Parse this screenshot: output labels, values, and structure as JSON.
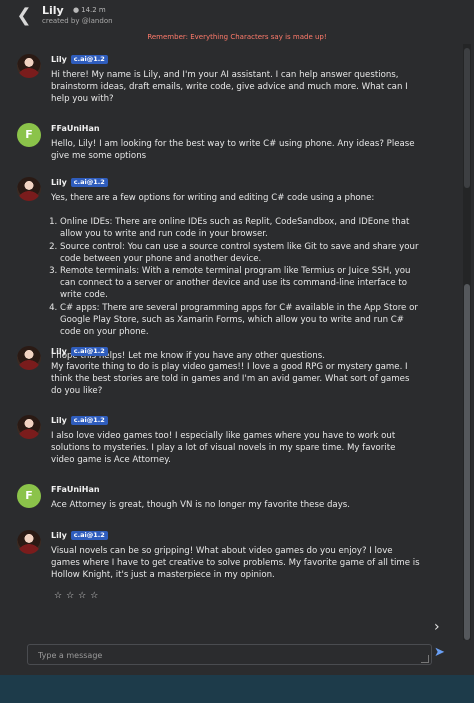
{
  "header": {
    "back_icon": "chevron-left-icon",
    "name": "Lily",
    "count": "14.2 m",
    "count_icon": "chat-icon",
    "created_by": "created by @landon"
  },
  "notice": "Remember: Everything Characters say is made up!",
  "messages": [
    {
      "sender": "Lily",
      "badge": "c.ai@1.2",
      "paragraphs": [
        "Hi there! My name is Lily, and I'm your AI assistant. I can help answer questions, brainstorm ideas, draft emails, write code, give advice and much more. What can I help you with?"
      ]
    },
    {
      "sender": "FFaUniHan",
      "avatar_letter": "F",
      "paragraphs": [
        "Hello, Lily! I am looking for the best way to write C# using phone. Any ideas? Please give me some options"
      ]
    },
    {
      "sender": "Lily",
      "badge": "c.ai@1.2",
      "intro": "Yes, there are a few options for writing and editing C# code using a phone:",
      "list": [
        "Online IDEs: There are online IDEs such as Replit, CodeSandbox, and IDEone that allow you to write and run code in your browser.",
        "Source control: You can use a source control system like Git to save and share your code between your phone and another device.",
        "Remote terminals: With a remote terminal program like Termius or Juice SSH, you can connect to a server or another device and use its command-line interface to write code.",
        "C# apps: There are several programming apps for C# available in the App Store or Google Play Store, such as Xamarin Forms, which allow you to write and run C# code on your phone."
      ],
      "outro": "I hope this helps! Let me know if you have any other questions."
    },
    {
      "sender": "Lily",
      "badge": "c.ai@1.2",
      "paragraphs": [
        "My favorite thing to do is play video games!! I love a good RPG or mystery game. I think the best stories are told in games and I'm an avid gamer. What sort of games do you like?"
      ]
    },
    {
      "sender": "Lily",
      "badge": "c.ai@1.2",
      "paragraphs": [
        "I also love video games too! I especially like games where you have to work out solutions to mysteries. I play a lot of visual novels in my spare time. My favorite video game is Ace Attorney."
      ]
    },
    {
      "sender": "FFaUniHan",
      "avatar_letter": "F",
      "paragraphs": [
        "Ace Attorney is great, though VN is no longer my favorite these days."
      ]
    },
    {
      "sender": "Lily",
      "badge": "c.ai@1.2",
      "paragraphs": [
        "Visual novels can be so gripping! What about video games do you enjoy? I love games where I have to get creative to solve problems. My favorite game of all time is Hollow Knight, it's just a masterpiece in my opinion."
      ]
    }
  ],
  "rating": {
    "stars": [
      "☆",
      "☆",
      "☆",
      "☆"
    ]
  },
  "next_icon": "chevron-right-icon",
  "composer": {
    "placeholder": "Type a message",
    "send_icon": "send-icon"
  }
}
